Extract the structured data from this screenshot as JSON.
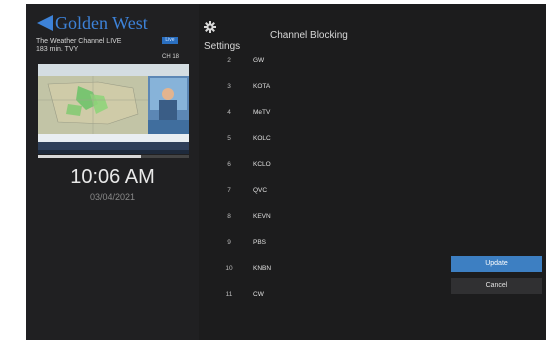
{
  "brand": {
    "name": "Golden West",
    "channel_info": "The Weather Channel LIVE",
    "duration": "183 min. TVY",
    "live_badge": "Live",
    "channel_tag": "CH 18"
  },
  "player": {
    "progress": 0.68
  },
  "clock": {
    "time": "10:06 AM",
    "date": "03/04/2021"
  },
  "settings": {
    "icon": "gear-icon",
    "label": "Settings"
  },
  "page": {
    "title": "Channel Blocking"
  },
  "channels": [
    {
      "number": "2",
      "name": "GW"
    },
    {
      "number": "3",
      "name": "KOTA"
    },
    {
      "number": "4",
      "name": "MeTV"
    },
    {
      "number": "5",
      "name": "KOLC"
    },
    {
      "number": "6",
      "name": "KCLO"
    },
    {
      "number": "7",
      "name": "QVC"
    },
    {
      "number": "8",
      "name": "KEVN"
    },
    {
      "number": "9",
      "name": "PBS"
    },
    {
      "number": "10",
      "name": "KNBN"
    },
    {
      "number": "11",
      "name": "CW"
    }
  ],
  "actions": {
    "update": "Update",
    "cancel": "Cancel"
  },
  "colors": {
    "accent": "#3d7fc2",
    "brand": "#3d82d8",
    "background": "#1c1c1d"
  }
}
